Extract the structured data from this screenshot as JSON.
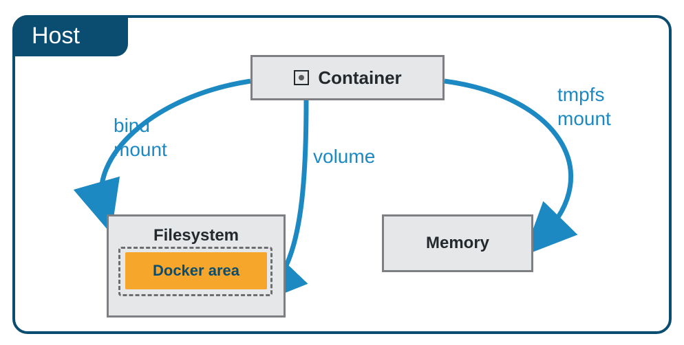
{
  "diagram": {
    "host_label": "Host",
    "container_label": "Container",
    "filesystem_label": "Filesystem",
    "docker_area_label": "Docker area",
    "memory_label": "Memory",
    "arrows": {
      "bind_mount": "bind\nmount",
      "volume": "volume",
      "tmpfs_mount": "tmpfs\nmount"
    },
    "colors": {
      "host_border": "#0b4d70",
      "box_fill": "#e5e7e9",
      "box_border": "#7d7f82",
      "arrow": "#1c89c2",
      "docker_area": "#f6a62a"
    }
  }
}
